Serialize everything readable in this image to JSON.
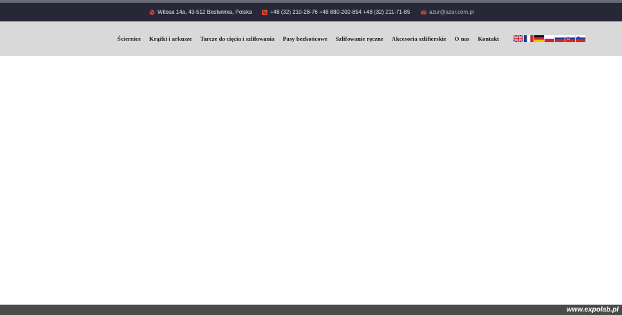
{
  "topbar": {
    "address": "Witosa 14a, 43-512 Bestwinka, Polska",
    "phones": "+48 (32) 210-28-76 +48 880-202-854 +48 (32) 211-71-85",
    "email": "azur@azur.com.pl",
    "icons": [
      "globe-icon",
      "phone-icon",
      "envelope-icon"
    ],
    "icon_color": "#d9442b",
    "background": "#262837"
  },
  "nav": {
    "items": [
      "Ściernice",
      "Krążki i arkusze",
      "Tarcze do cięcia i szlifowania",
      "Pasy bezkońcowe",
      "Szlifowanie ręczne",
      "Akcesoria szlifierskie",
      "O nas",
      "Kontakt"
    ],
    "background": "#d9d9d9"
  },
  "languages": [
    "en",
    "fr",
    "de",
    "pl",
    "ru",
    "sk",
    "si"
  ],
  "footer": {
    "watermark": "www.expolab.pl"
  }
}
